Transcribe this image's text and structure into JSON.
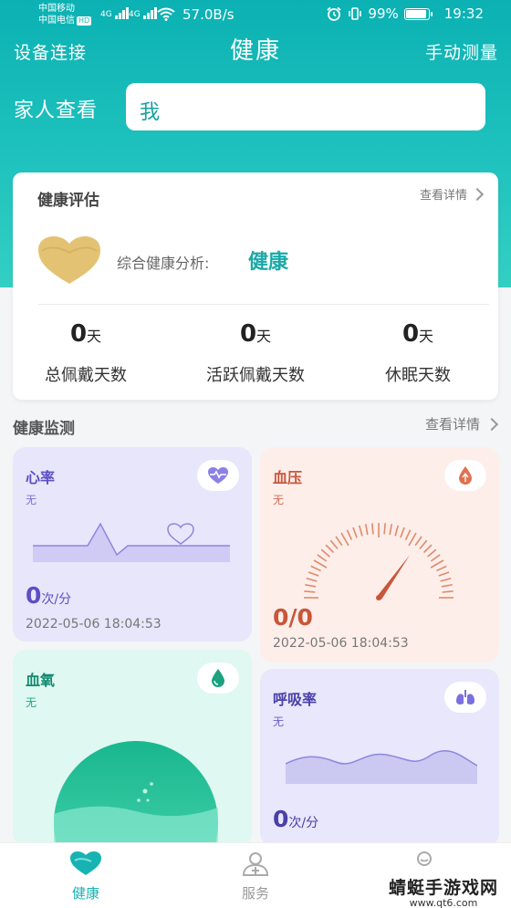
{
  "status_bar": {
    "carrier_1": "中国移动",
    "carrier_2": "中国电信",
    "hd_badge": "HD",
    "net_1": "4G",
    "net_2": "4G",
    "speed": "57.0B/s",
    "battery": "99%",
    "time": "19:32"
  },
  "nav": {
    "left": "设备连接",
    "title": "健康",
    "right": "手动测量"
  },
  "family": {
    "label": "家人查看",
    "value": "我"
  },
  "assessment": {
    "title": "健康评估",
    "detail": "查看详情",
    "analysis_label": "综合健康分析:",
    "analysis_value": "健康",
    "stats": [
      {
        "value": "0",
        "unit": "天",
        "label": "总佩戴天数"
      },
      {
        "value": "0",
        "unit": "天",
        "label": "活跃佩戴天数"
      },
      {
        "value": "0",
        "unit": "天",
        "label": "休眠天数"
      }
    ]
  },
  "monitor": {
    "title": "健康监测",
    "detail": "查看详情",
    "heart_rate": {
      "title": "心率",
      "sub": "无",
      "value": "0",
      "unit": "次/分",
      "time": "2022-05-06 18:04:53"
    },
    "blood_pressure": {
      "title": "血压",
      "sub": "无",
      "value": "0/0",
      "time": "2022-05-06 18:04:53"
    },
    "blood_oxygen": {
      "title": "血氧",
      "sub": "无"
    },
    "respiration": {
      "title": "呼吸率",
      "sub": "无",
      "value": "0",
      "unit": "次/分"
    }
  },
  "tabs": [
    {
      "label": "健康"
    },
    {
      "label": "服务"
    }
  ],
  "watermark": {
    "title": "蜻蜓手游戏网",
    "url": "www.qt6.com"
  },
  "colors": {
    "teal": "#17b3b3",
    "heart_card": "#e7e6fb",
    "bp_card": "#fdeeea",
    "oxygen_card": "#dff8f1",
    "resp_card": "#e8e7fb"
  }
}
